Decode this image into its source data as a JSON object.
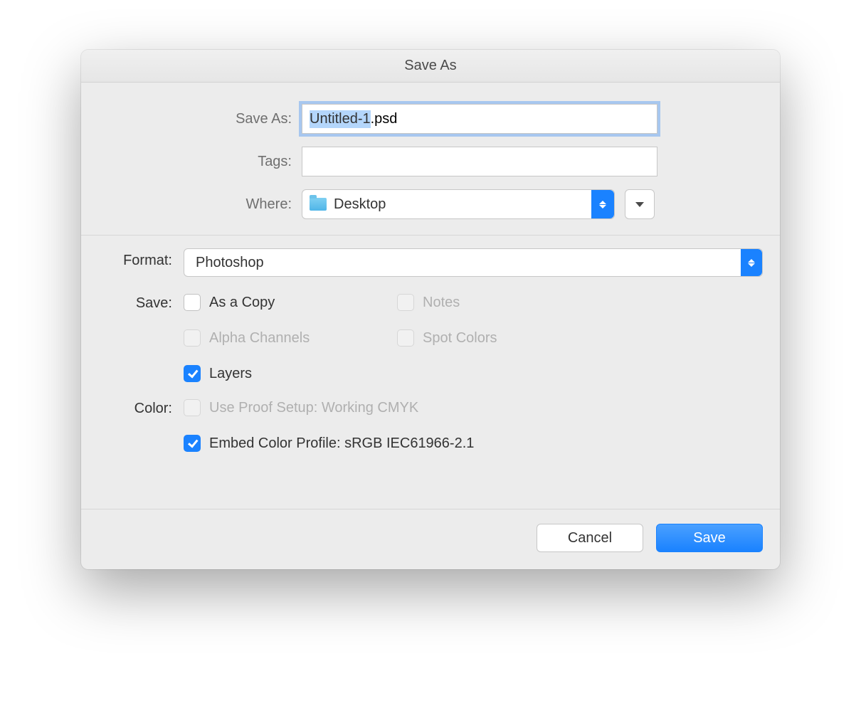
{
  "dialog": {
    "title": "Save As",
    "saveas_label": "Save As:",
    "filename_base": "Untitled-1",
    "filename_ext": ".psd",
    "tags_label": "Tags:",
    "tags_value": "",
    "where_label": "Where:",
    "where_value": "Desktop"
  },
  "format": {
    "label": "Format:",
    "value": "Photoshop"
  },
  "save": {
    "label": "Save:",
    "as_copy": "As a Copy",
    "notes": "Notes",
    "alpha": "Alpha Channels",
    "spot": "Spot Colors",
    "layers": "Layers"
  },
  "color": {
    "label": "Color:",
    "proof": "Use Proof Setup:  Working CMYK",
    "embed": "Embed Color Profile:  sRGB IEC61966-2.1"
  },
  "buttons": {
    "cancel": "Cancel",
    "save": "Save"
  }
}
